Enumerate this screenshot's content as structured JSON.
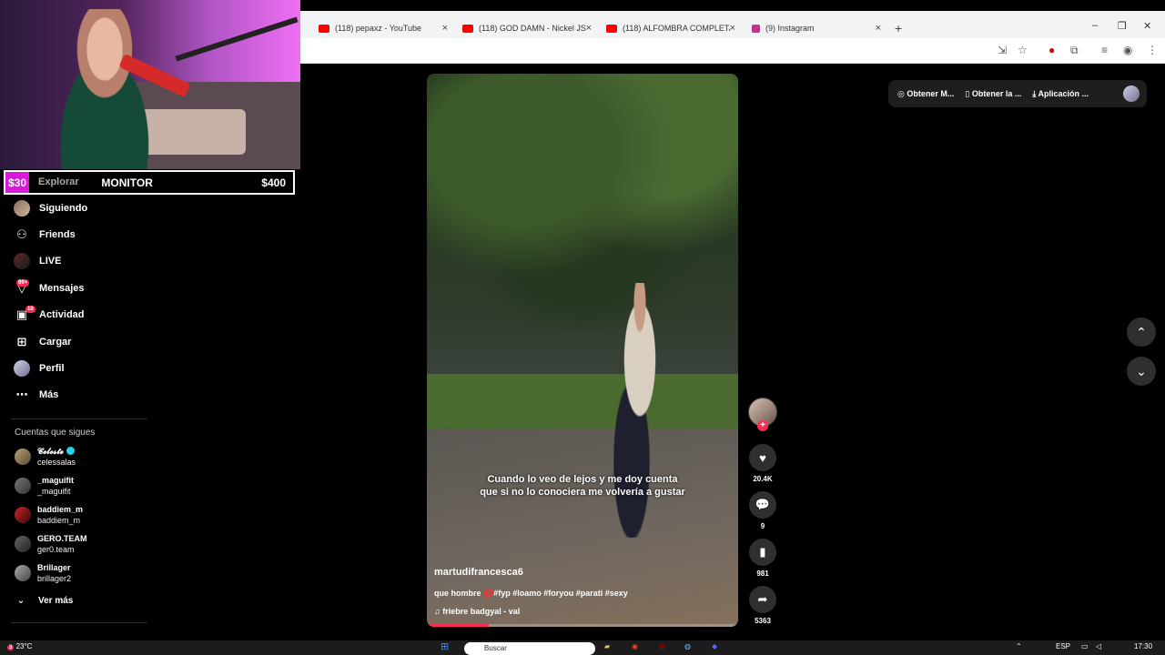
{
  "browser": {
    "tabs": [
      {
        "title": "(118) pepaxz - YouTube",
        "favicon": "youtube-icon",
        "color": "#ff0000"
      },
      {
        "title": "(118) GOD DAMN - Nickel JS | C",
        "favicon": "youtube-icon",
        "color": "#ff0000"
      },
      {
        "title": "(118) ALFOMBRA COMPLETA de",
        "favicon": "youtube-icon",
        "color": "#ff0000"
      },
      {
        "title": "(9) Instagram",
        "favicon": "instagram-icon",
        "color": "#c13584"
      }
    ],
    "new_tab": "+",
    "close": "×"
  },
  "stream": {
    "goal_left": "$30",
    "goal_mid": "MONITOR",
    "goal_right": "$400"
  },
  "sidebar": {
    "items": [
      {
        "label": "Explorar",
        "icon": "compass-icon"
      },
      {
        "label": "Siguiendo",
        "icon": "following-avatar"
      },
      {
        "label": "Friends",
        "icon": "friends-icon"
      },
      {
        "label": "LIVE",
        "icon": "live-icon"
      },
      {
        "label": "Mensajes",
        "icon": "messages-icon",
        "badge": "99+"
      },
      {
        "label": "Actividad",
        "icon": "activity-icon",
        "badge": "10"
      },
      {
        "label": "Cargar",
        "icon": "upload-icon"
      },
      {
        "label": "Perfil",
        "icon": "profile-avatar"
      },
      {
        "label": "Más",
        "icon": "more-icon"
      }
    ],
    "following_header": "Cuentas que sigues",
    "accounts": [
      {
        "name": "𝓒𝓮𝓵𝓮𝓼𝓽𝓮",
        "handle": "celessalas",
        "verified": true
      },
      {
        "name": "_maguifit",
        "handle": "_maguifit"
      },
      {
        "name": "baddiem_m",
        "handle": "baddiem_m"
      },
      {
        "name": "GERO.TEAM",
        "handle": "ger0.team"
      },
      {
        "name": "Brillager",
        "handle": "brillager2"
      }
    ],
    "see_more": "Ver más"
  },
  "video": {
    "caption": "Cuando lo veo de lejos y me doy cuenta que si no lo conociera me volvería a gustar",
    "username": "martudifrancesca6",
    "description": "que hombre 💋#fyp #loamo #foryou #parati #sexy",
    "music": "friebre badgyal - val",
    "progress": 0.2
  },
  "actions": {
    "likes": "20.4K",
    "comments": "9",
    "saves": "981",
    "shares": "5363"
  },
  "topbar": {
    "get_coins": "Obtener M...",
    "get_app": "Obtener la ...",
    "desktop_app": "Aplicación ..."
  },
  "taskbar": {
    "weather": "23°C",
    "weather_badge": "3",
    "search": "Buscar",
    "lang": "ESP",
    "time": "17:30"
  },
  "colors": {
    "accent": "#fe2c55",
    "goal_fill": "#d91ad9"
  }
}
